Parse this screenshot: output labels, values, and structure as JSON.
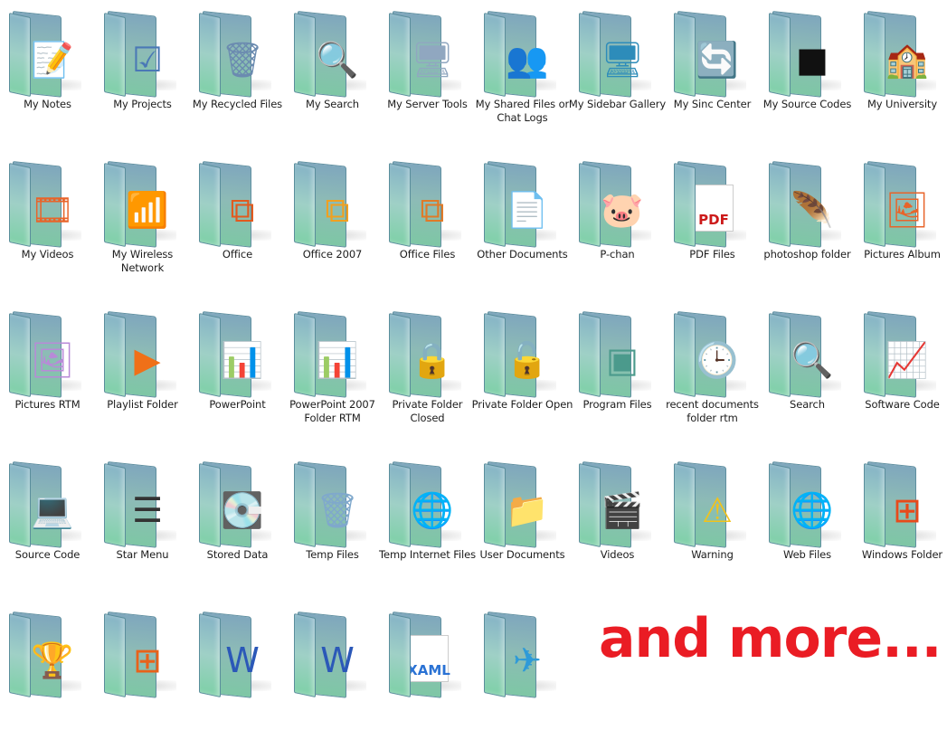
{
  "folders": [
    {
      "label": "My Notes",
      "icon": "sticky-note-icon",
      "glyph": "📝",
      "color": "#f4dc6a"
    },
    {
      "label": "My Projects",
      "icon": "checklist-icon",
      "glyph": "☑",
      "color": "#4a78b6"
    },
    {
      "label": "My Recycled Files",
      "icon": "recycle-bin-full-icon",
      "glyph": "🗑",
      "color": "#6b8bb0"
    },
    {
      "label": "My Search",
      "icon": "magnifier-monitor-icon",
      "glyph": "🔍",
      "color": "#2a4fc4"
    },
    {
      "label": "My Server Tools",
      "icon": "server-tower-icon",
      "glyph": "🖥",
      "color": "#90a7c0"
    },
    {
      "label": "My Shared Files or Chat Logs",
      "icon": "messenger-users-icon",
      "glyph": "👥",
      "color": "#4aa84a"
    },
    {
      "label": "My Sidebar Gallery",
      "icon": "sidebar-monitor-icon",
      "glyph": "🖥",
      "color": "#2d8cba"
    },
    {
      "label": "My Sinc Center",
      "icon": "sync-center-icon",
      "glyph": "🔄",
      "color": "#5cc23e"
    },
    {
      "label": "My Source Codes",
      "icon": "black-screen-icon",
      "glyph": "■",
      "color": "#111111"
    },
    {
      "label": "My University",
      "icon": "university-sign-icon",
      "glyph": "🏫",
      "color": "#e2c82a"
    },
    {
      "label": "My Videos",
      "icon": "film-strip-icon",
      "glyph": "🎞",
      "color": "#e8642a"
    },
    {
      "label": "My Wireless Network",
      "icon": "wireless-router-icon",
      "glyph": "📶",
      "color": "#8e8e8e"
    },
    {
      "label": "Office",
      "icon": "office-logo-icon",
      "glyph": "⧉",
      "color": "#e25a1e"
    },
    {
      "label": "Office 2007",
      "icon": "office-2007-logo-icon",
      "glyph": "⧉",
      "color": "#f0a020"
    },
    {
      "label": "Office Files",
      "icon": "office-files-icon",
      "glyph": "⧉",
      "color": "#e07a28"
    },
    {
      "label": "Other Documents",
      "icon": "blank-document-icon",
      "glyph": "📄",
      "color": "#dfe6ee"
    },
    {
      "label": "P-chan",
      "icon": "p-chan-picture-icon",
      "glyph": "🐷",
      "color": "#1d6bb0"
    },
    {
      "label": "PDF Files",
      "icon": "pdf-adobe-icon",
      "glyph": "PDF",
      "color": "#cc1a1a"
    },
    {
      "label": "photoshop folder",
      "icon": "photoshop-feather-icon",
      "glyph": "🪶",
      "color": "#3d8fd0"
    },
    {
      "label": "Pictures Album",
      "icon": "picture-album-icon",
      "glyph": "🖼",
      "color": "#e8642a"
    },
    {
      "label": "Pictures RTM",
      "icon": "pictures-stack-icon",
      "glyph": "🖼",
      "color": "#b88ad8"
    },
    {
      "label": "Playlist Folder",
      "icon": "play-button-icon",
      "glyph": "▶",
      "color": "#f07018"
    },
    {
      "label": "PowerPoint",
      "icon": "powerpoint-icon",
      "glyph": "📊",
      "color": "#d8401a"
    },
    {
      "label": "PowerPoint 2007 Folder RTM",
      "icon": "powerpoint-2007-icon",
      "glyph": "📊",
      "color": "#e04a2a"
    },
    {
      "label": "Private Folder Closed",
      "icon": "padlock-closed-icon",
      "glyph": "🔒",
      "color": "#c9a23a"
    },
    {
      "label": "Private Folder Open",
      "icon": "padlock-open-icon",
      "glyph": "🔓",
      "color": "#c9a23a"
    },
    {
      "label": "Program Files",
      "icon": "program-window-icon",
      "glyph": "▣",
      "color": "#4b9a8c"
    },
    {
      "label": "recent documents folder rtm",
      "icon": "recent-documents-clock-icon",
      "glyph": "🕒",
      "color": "#6a8fb8"
    },
    {
      "label": "Search",
      "icon": "magnifying-glass-icon",
      "glyph": "🔍",
      "color": "#8ab4d8"
    },
    {
      "label": "Software Code",
      "icon": "software-code-monitor-icon",
      "glyph": "📈",
      "color": "#2e4a3a"
    },
    {
      "label": "Source Code",
      "icon": "computer-keyboard-icon",
      "glyph": "💻",
      "color": "#2d8cba"
    },
    {
      "label": "Star Menu",
      "icon": "start-menu-icon",
      "glyph": "☰",
      "color": "#333333"
    },
    {
      "label": "Stored Data",
      "icon": "hard-drive-icon",
      "glyph": "💽",
      "color": "#6aa8d8"
    },
    {
      "label": "Temp Files",
      "icon": "recycle-bin-empty-icon",
      "glyph": "🗑",
      "color": "#7fa8cc"
    },
    {
      "label": "Temp Internet Files",
      "icon": "globe-network-icon",
      "glyph": "🌐",
      "color": "#2c7ad0"
    },
    {
      "label": "User Documents",
      "icon": "user-documents-icon",
      "glyph": "📁",
      "color": "#e6c56a"
    },
    {
      "label": "Videos",
      "icon": "video-film-icon",
      "glyph": "🎬",
      "color": "#1f1f1f"
    },
    {
      "label": "Warning",
      "icon": "warning-triangle-icon",
      "glyph": "⚠",
      "color": "#f2c21a"
    },
    {
      "label": "Web Files",
      "icon": "globe-icon",
      "glyph": "🌐",
      "color": "#2466c8"
    },
    {
      "label": "Windows Folder",
      "icon": "windows-logo-icon",
      "glyph": "⊞",
      "color": "#e84a1a"
    },
    {
      "label": "",
      "icon": "trophy-cup-icon",
      "glyph": "🏆",
      "color": "#f08a2a"
    },
    {
      "label": "",
      "icon": "windows-flag-icon",
      "glyph": "⊞",
      "color": "#e8621a"
    },
    {
      "label": "",
      "icon": "word-document-icon",
      "glyph": "W",
      "color": "#2b58b8"
    },
    {
      "label": "",
      "icon": "word-2007-document-icon",
      "glyph": "W",
      "color": "#2b58b8"
    },
    {
      "label": "",
      "icon": "xaml-file-icon",
      "glyph": "XAML",
      "color": "#2a72d4"
    },
    {
      "label": "",
      "icon": "paper-plane-icon",
      "glyph": "✈",
      "color": "#2e9ad8"
    }
  ],
  "footer": {
    "more_text": "and more...",
    "more_color": "#ea1c24"
  }
}
